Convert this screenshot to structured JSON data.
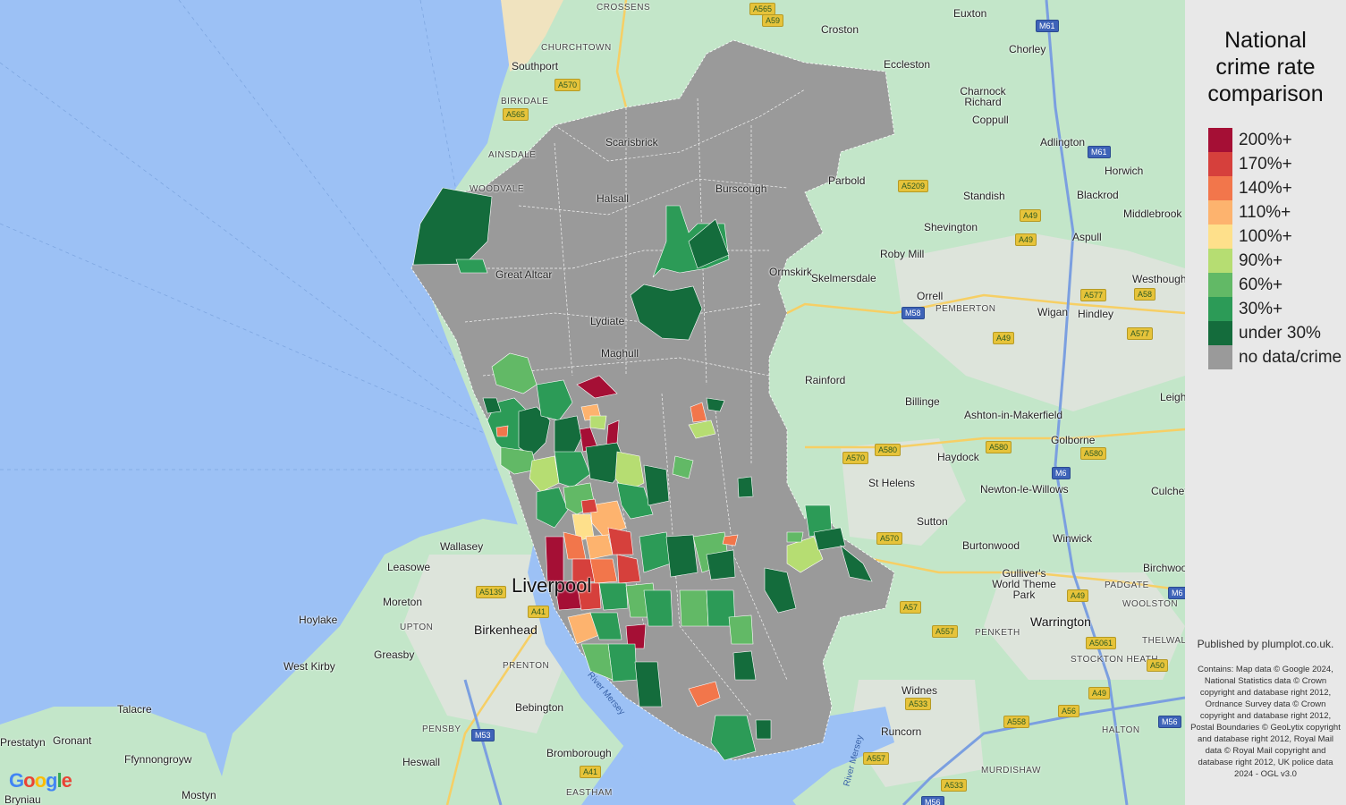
{
  "legend": {
    "title": "National crime rate comparison",
    "items": [
      {
        "label": "200%+",
        "color": "#a50f35"
      },
      {
        "label": "170%+",
        "color": "#d6403c"
      },
      {
        "label": "140%+",
        "color": "#f2764b"
      },
      {
        "label": "110%+",
        "color": "#fdb36e"
      },
      {
        "label": "100%+",
        "color": "#fee08b"
      },
      {
        "label": "90%+",
        "color": "#b6dd72"
      },
      {
        "label": "60%+",
        "color": "#62b966"
      },
      {
        "label": "30%+",
        "color": "#2c9b57"
      },
      {
        "label": "under 30%",
        "color": "#146c3c"
      },
      {
        "label": "no data/crime",
        "color": "#9a9a9a"
      }
    ]
  },
  "published": "Published by plumplot.co.uk.",
  "attribution": "Contains: Map data © Google 2024, National Statistics data © Crown copyright and database right 2012, Ordnance Survey data © Crown copyright and database right 2012, Postal Boundaries © GeoLytix copyright and database right 2012, Royal Mail data © Royal Mail copyright and database right 2012, UK police data 2024 - OGL v3.0",
  "map": {
    "places": [
      {
        "name": "CROSSENS",
        "cls": "small"
      },
      {
        "name": "Croston",
        "cls": ""
      },
      {
        "name": "Euxton",
        "cls": ""
      },
      {
        "name": "CHURCHTOWN",
        "cls": "small"
      },
      {
        "name": "Southport",
        "cls": ""
      },
      {
        "name": "Eccleston",
        "cls": ""
      },
      {
        "name": "Chorley",
        "cls": ""
      },
      {
        "name": "BIRKDALE",
        "cls": "small"
      },
      {
        "name": "Charnock Richard",
        "cls": ""
      },
      {
        "name": "Coppull",
        "cls": ""
      },
      {
        "name": "Scarisbrick",
        "cls": ""
      },
      {
        "name": "Adlington",
        "cls": ""
      },
      {
        "name": "AINSDALE",
        "cls": "small"
      },
      {
        "name": "Horwich",
        "cls": ""
      },
      {
        "name": "WOODVALE",
        "cls": "small"
      },
      {
        "name": "Burscough",
        "cls": ""
      },
      {
        "name": "Parbold",
        "cls": ""
      },
      {
        "name": "Blackrod",
        "cls": ""
      },
      {
        "name": "Halsall",
        "cls": ""
      },
      {
        "name": "Standish",
        "cls": ""
      },
      {
        "name": "Middlebrook",
        "cls": ""
      },
      {
        "name": "Shevington",
        "cls": ""
      },
      {
        "name": "Aspull",
        "cls": ""
      },
      {
        "name": "Roby Mill",
        "cls": ""
      },
      {
        "name": "Great Altcar",
        "cls": ""
      },
      {
        "name": "Ormskirk",
        "cls": ""
      },
      {
        "name": "Skelmersdale",
        "cls": ""
      },
      {
        "name": "Westhoughton",
        "cls": ""
      },
      {
        "name": "Orrell",
        "cls": ""
      },
      {
        "name": "Wigan",
        "cls": ""
      },
      {
        "name": "PEMBERTON",
        "cls": "small"
      },
      {
        "name": "Hindley",
        "cls": ""
      },
      {
        "name": "Lydiate",
        "cls": ""
      },
      {
        "name": "Maghull",
        "cls": ""
      },
      {
        "name": "Rainford",
        "cls": ""
      },
      {
        "name": "Billinge",
        "cls": ""
      },
      {
        "name": "Leigh",
        "cls": ""
      },
      {
        "name": "Ashton-in-Makerfield",
        "cls": ""
      },
      {
        "name": "Golborne",
        "cls": ""
      },
      {
        "name": "Haydock",
        "cls": ""
      },
      {
        "name": "St Helens",
        "cls": ""
      },
      {
        "name": "Newton-le-Willows",
        "cls": ""
      },
      {
        "name": "Culcheth",
        "cls": ""
      },
      {
        "name": "Sutton",
        "cls": ""
      },
      {
        "name": "Winwick",
        "cls": ""
      },
      {
        "name": "Burtonwood",
        "cls": ""
      },
      {
        "name": "Wallasey",
        "cls": ""
      },
      {
        "name": "Leasowe",
        "cls": ""
      },
      {
        "name": "Birchwood",
        "cls": ""
      },
      {
        "name": "Gulliver's World Theme Park",
        "cls": ""
      },
      {
        "name": "PADGATE",
        "cls": "small"
      },
      {
        "name": "Moreton",
        "cls": ""
      },
      {
        "name": "Liverpool",
        "cls": "huge"
      },
      {
        "name": "WOOLSTON",
        "cls": "small"
      },
      {
        "name": "Hoylake",
        "cls": ""
      },
      {
        "name": "Warrington",
        "cls": "big"
      },
      {
        "name": "UPTON",
        "cls": "small"
      },
      {
        "name": "Birkenhead",
        "cls": "big"
      },
      {
        "name": "PENKETH",
        "cls": "small"
      },
      {
        "name": "THELWALL",
        "cls": "small"
      },
      {
        "name": "Greasby",
        "cls": ""
      },
      {
        "name": "STOCKTON HEATH",
        "cls": "small"
      },
      {
        "name": "West Kirby",
        "cls": ""
      },
      {
        "name": "PRENTON",
        "cls": "small"
      },
      {
        "name": "Widnes",
        "cls": ""
      },
      {
        "name": "Talacre",
        "cls": ""
      },
      {
        "name": "Bebington",
        "cls": ""
      },
      {
        "name": "Prestatyn",
        "cls": ""
      },
      {
        "name": "Gronant",
        "cls": ""
      },
      {
        "name": "PENSBY",
        "cls": "small"
      },
      {
        "name": "Runcorn",
        "cls": ""
      },
      {
        "name": "Ffynnongroyw",
        "cls": ""
      },
      {
        "name": "Heswall",
        "cls": ""
      },
      {
        "name": "Bromborough",
        "cls": ""
      },
      {
        "name": "HALTON",
        "cls": "small"
      },
      {
        "name": "Mostyn",
        "cls": ""
      },
      {
        "name": "EASTHAM",
        "cls": "small"
      },
      {
        "name": "MURDISHAW",
        "cls": "small"
      },
      {
        "name": "Bryniau",
        "cls": ""
      }
    ],
    "roads": [
      {
        "ref": "A565",
        "kind": "a"
      },
      {
        "ref": "A59",
        "kind": "a"
      },
      {
        "ref": "M61",
        "kind": "m"
      },
      {
        "ref": "A570",
        "kind": "a"
      },
      {
        "ref": "A565",
        "kind": "a"
      },
      {
        "ref": "M61",
        "kind": "m"
      },
      {
        "ref": "A5209",
        "kind": "a"
      },
      {
        "ref": "A49",
        "kind": "a"
      },
      {
        "ref": "A49",
        "kind": "a"
      },
      {
        "ref": "A577",
        "kind": "a"
      },
      {
        "ref": "A58",
        "kind": "a"
      },
      {
        "ref": "M58",
        "kind": "m"
      },
      {
        "ref": "A49",
        "kind": "a"
      },
      {
        "ref": "A577",
        "kind": "a"
      },
      {
        "ref": "A570",
        "kind": "a"
      },
      {
        "ref": "A580",
        "kind": "a"
      },
      {
        "ref": "A580",
        "kind": "a"
      },
      {
        "ref": "A580",
        "kind": "a"
      },
      {
        "ref": "M6",
        "kind": "m"
      },
      {
        "ref": "A570",
        "kind": "a"
      },
      {
        "ref": "A5139",
        "kind": "a"
      },
      {
        "ref": "A41",
        "kind": "a"
      },
      {
        "ref": "A49",
        "kind": "a"
      },
      {
        "ref": "M6",
        "kind": "m"
      },
      {
        "ref": "A57",
        "kind": "a"
      },
      {
        "ref": "A557",
        "kind": "a"
      },
      {
        "ref": "A5061",
        "kind": "a"
      },
      {
        "ref": "A50",
        "kind": "a"
      },
      {
        "ref": "A533",
        "kind": "a"
      },
      {
        "ref": "A49",
        "kind": "a"
      },
      {
        "ref": "M53",
        "kind": "m"
      },
      {
        "ref": "A558",
        "kind": "a"
      },
      {
        "ref": "A56",
        "kind": "a"
      },
      {
        "ref": "M56",
        "kind": "m"
      },
      {
        "ref": "A557",
        "kind": "a"
      },
      {
        "ref": "A41",
        "kind": "a"
      },
      {
        "ref": "A533",
        "kind": "a"
      },
      {
        "ref": "M56",
        "kind": "m"
      }
    ],
    "water_labels": [
      "River Mersey",
      "River Mersey"
    ],
    "logo": "Google"
  }
}
